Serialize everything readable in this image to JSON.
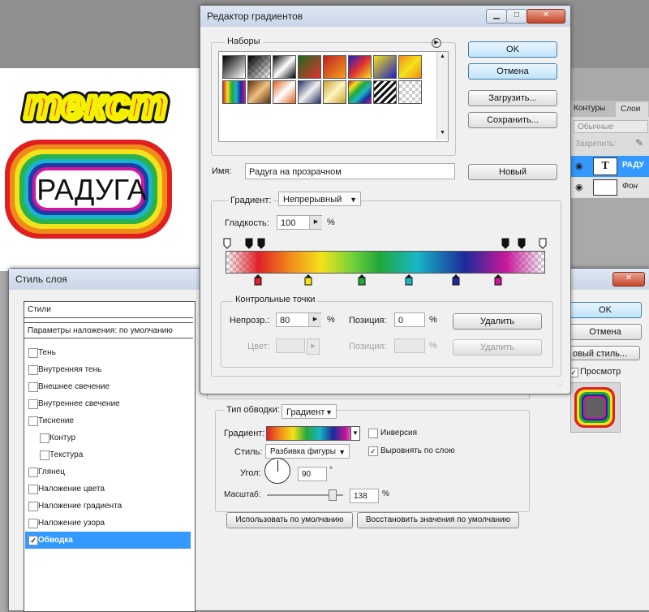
{
  "canvas": {
    "word1": "текст",
    "word2": "РАДУГА"
  },
  "layers_panel": {
    "tab_contours": "Контуры",
    "tab_layers": "Слои",
    "blend_mode": "Обычные",
    "lock_label": "Закрепить:",
    "layer_text_name": "РАДУ",
    "layer_text_thumb": "T",
    "layer_bg_name": "Фон"
  },
  "layer_style": {
    "title": "Стиль слоя",
    "styles_header": "Стили",
    "blend_defaults": "Параметры наложения: по умолчанию",
    "items": [
      {
        "label": "Тень",
        "checked": false,
        "indent": false
      },
      {
        "label": "Внутренняя тень",
        "checked": false,
        "indent": false
      },
      {
        "label": "Внешнее свечение",
        "checked": false,
        "indent": false
      },
      {
        "label": "Внутреннее свечение",
        "checked": false,
        "indent": false
      },
      {
        "label": "Тиснение",
        "checked": false,
        "indent": false
      },
      {
        "label": "Контур",
        "checked": false,
        "indent": true
      },
      {
        "label": "Текстура",
        "checked": false,
        "indent": true
      },
      {
        "label": "Глянец",
        "checked": false,
        "indent": false
      },
      {
        "label": "Наложение цвета",
        "checked": false,
        "indent": false
      },
      {
        "label": "Наложение градиента",
        "checked": false,
        "indent": false
      },
      {
        "label": "Наложение узора",
        "checked": false,
        "indent": false
      },
      {
        "label": "Обводка",
        "checked": true,
        "indent": false
      }
    ],
    "fill_type_label": "Тип обводки:",
    "fill_type_value": "Градиент",
    "gradient_label": "Градиент:",
    "inverse_label": "Инверсия",
    "style_label": "Стиль:",
    "style_value": "Разбивка фигуры",
    "align_label": "Выровнять по слою",
    "angle_label": "Угол:",
    "angle_value": "90",
    "angle_unit": "°",
    "scale_label": "Масштаб:",
    "scale_value": "138",
    "scale_unit": "%",
    "scale_level_pct": 85,
    "use_default_button": "Использовать по умолчанию",
    "restore_default_button": "Восстановить значения по умолчанию",
    "ok_button": "OK",
    "cancel_button": "Отмена",
    "new_style_button": "овый стиль...",
    "preview_label": "Просмотр",
    "align_checked": true,
    "preview_checked": true
  },
  "gradient_editor": {
    "title": "Редактор градиентов",
    "presets_label": "Наборы",
    "ok_button": "OK",
    "cancel_button": "Отмена",
    "load_button": "Загрузить...",
    "save_button": "Сохранить...",
    "name_label": "Имя:",
    "name_value": "Радуга на прозрачном",
    "new_button": "Новый",
    "gradient_type_label": "Градиент:",
    "gradient_type_value": "Непрерывный",
    "smoothness_label": "Гладкость:",
    "smoothness_value": "100",
    "smoothness_unit": "%",
    "stops_group_label": "Контрольные точки",
    "opacity_label": "Непрозр.:",
    "opacity_value": "80",
    "opacity_unit": "%",
    "position_label": "Позиция:",
    "position_value": "0",
    "position_unit": "%",
    "delete_button": "Удалить",
    "color_label": "Цвет:",
    "position2_label": "Позиция:",
    "position2_unit": "%",
    "delete2_button": "Удалить",
    "color_stops": [
      "#e0202a",
      "#f4e21a",
      "#23a73a",
      "#17b6c6",
      "#1c2a9a",
      "#c8189a"
    ],
    "accent_color": "#3399ff"
  }
}
